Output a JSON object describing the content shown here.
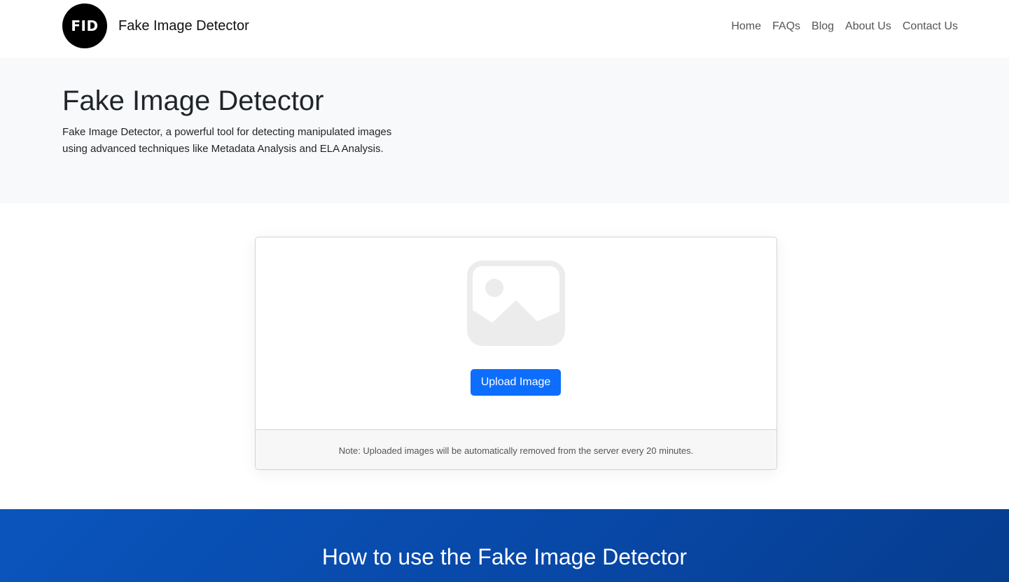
{
  "header": {
    "logo_text": "FID",
    "brand_name": "Fake Image Detector",
    "nav": [
      {
        "label": "Home"
      },
      {
        "label": "FAQs"
      },
      {
        "label": "Blog"
      },
      {
        "label": "About Us"
      },
      {
        "label": "Contact Us"
      }
    ]
  },
  "hero": {
    "title": "Fake Image Detector",
    "description": "Fake Image Detector, a powerful tool for detecting manipulated images using advanced techniques like Metadata Analysis and ELA Analysis."
  },
  "upload": {
    "icon": "image-placeholder-icon",
    "button_label": "Upload Image",
    "note": "Note: Uploaded images will be automatically removed from the server every 20 minutes."
  },
  "howto": {
    "title": "How to use the Fake Image Detector"
  },
  "colors": {
    "accent": "#0d6efd",
    "hero_bg": "#f8f9fa",
    "section_blue": "#0847a5"
  }
}
